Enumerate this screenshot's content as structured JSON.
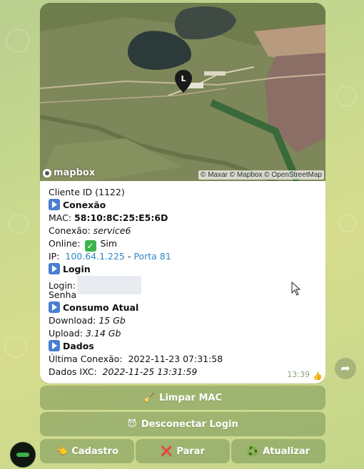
{
  "map": {
    "logo_text": "mapbox",
    "attribution": "© Maxar © Mapbox © OpenStreetMap",
    "pin_label": "L"
  },
  "message": {
    "cliente_id": "Cliente ID (1122)",
    "section_conexao": "Conexão",
    "mac_label": "MAC:",
    "mac_value": "58:10:8C:25:E5:6D",
    "conexao_label": "Conexão:",
    "conexao_value": "service6",
    "online_label": "Online:",
    "online_value": "Sim",
    "ip_label": "IP:",
    "ip_value": "100.64.1.225",
    "ip_sep": "-",
    "porta_value": "Porta 81",
    "section_login": "Login",
    "login_label": "Login:",
    "senha_label": "Senha",
    "section_consumo": "Consumo Atual",
    "download_label": "Download:",
    "download_value": "15 Gb",
    "upload_label": "Upload:",
    "upload_value": "3.14 Gb",
    "section_dados": "Dados",
    "ultima_label": "Última Conexão:",
    "ultima_value": "2022-11-23 07:31:58",
    "dados_ixc_label": "Dados IXC:",
    "dados_ixc_value": "2022-11-25 13:31:59",
    "time": "13:39",
    "reaction": "👍"
  },
  "buttons": {
    "limpar_mac": {
      "emoji": "🧹",
      "label": "Limpar MAC"
    },
    "desconectar": {
      "emoji": "😈",
      "label": "Desconectar Login"
    },
    "cadastro": {
      "emoji": "👈",
      "label": "Cadastro"
    },
    "parar": {
      "emoji": "❌",
      "label": "Parar"
    },
    "atualizar": {
      "emoji": "♻️",
      "label": "Atualizar"
    }
  },
  "icons": {
    "share": "share-icon",
    "section": "play-button-icon",
    "online": "check-mark-icon"
  },
  "colors": {
    "link": "#2f87c7",
    "section_icon": "#4a7ed0",
    "check": "#3bb54a",
    "time": "#8aa27a"
  }
}
